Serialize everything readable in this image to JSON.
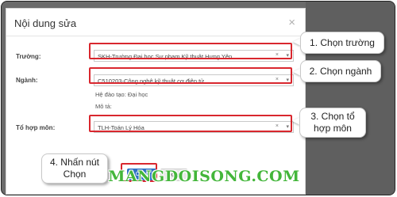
{
  "dialog": {
    "title": "Nội dung sửa",
    "close_glyph": "×"
  },
  "form": {
    "truong": {
      "label": "Trường:",
      "value": "SKH-Trường Đại học Sư phạm Kỹ thuật Hưng Yên",
      "clear": "×",
      "caret": "▾"
    },
    "nganh": {
      "label": "Ngành:",
      "value": "C510203-Công nghệ kỹ thuật cơ điện tử",
      "clear": "×",
      "caret": "▾"
    },
    "he_dao_tao": "Hệ đào tạo: Đại học",
    "mo_ta": "Mô tả:",
    "to_hop": {
      "label": "Tổ hợp môn:",
      "value": "TLH-Toán Lý Hóa",
      "clear": "×",
      "caret": "▾"
    }
  },
  "buttons": {
    "primary_label": "Chọn",
    "secondary_label": "Đóng"
  },
  "callouts": {
    "c1": "1. Chọn trường",
    "c2": "2. Chọn ngành",
    "c3_line1": "3. Chọn tổ",
    "c3_line2": "hợp môn",
    "c4_line1": "4. Nhấn nút",
    "c4_line2": "Chọn"
  },
  "watermark": "MANGDOISONG.COM",
  "colors": {
    "highlight": "#d9272e",
    "primary_button": "#2f72c4",
    "watermark": "#43b63a"
  }
}
